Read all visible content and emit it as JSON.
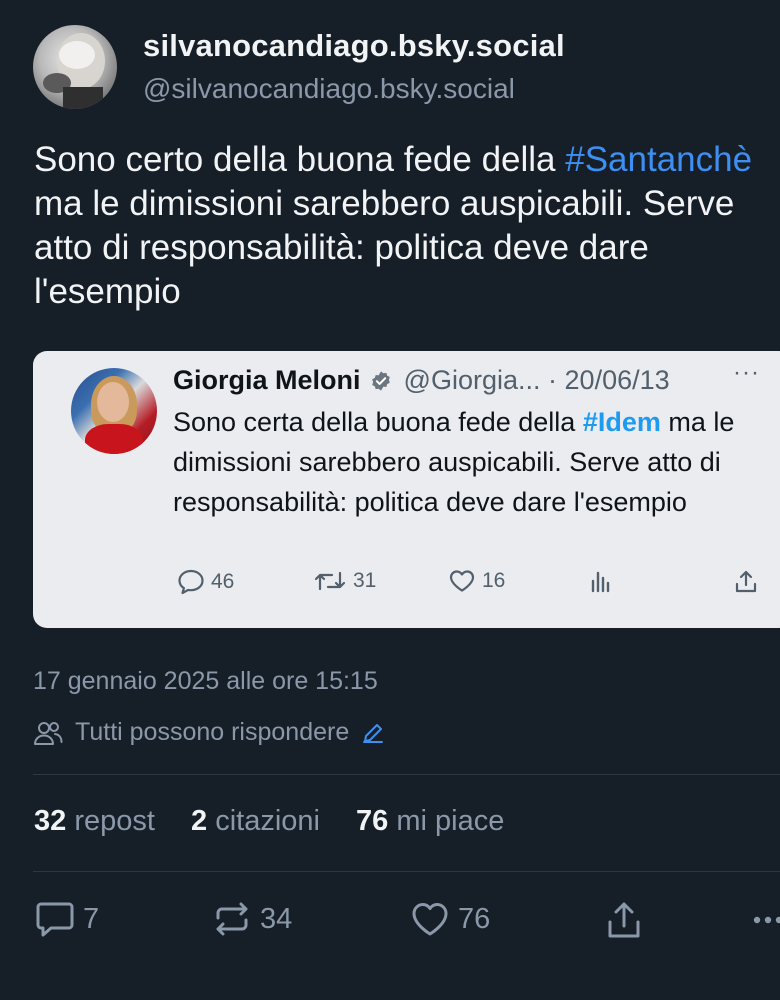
{
  "post": {
    "author_name": "silvanocandiago.bsky.social",
    "author_handle": "@silvanocandiago.bsky.social",
    "text_before": "Sono certo della buona fede della ",
    "hashtag": "#Santanchè",
    "text_after": " ma le dimissioni sarebbero auspicabili. Serve atto di responsabilità: politica deve dare l'esempio",
    "timestamp": "17 gennaio 2025 alle ore 15:15",
    "reply_setting": "Tutti possono rispondere"
  },
  "embed": {
    "author_name": "Giorgia Meloni",
    "author_handle": "@Giorgia...",
    "separator": "·",
    "date": "20/06/13",
    "more": "···",
    "text_before": "Sono certa della buona fede della ",
    "hashtag": "#Idem",
    "text_after": " ma le dimissioni sarebbero auspicabili. Serve atto di responsabilità: politica deve dare l'esempio",
    "replies": "46",
    "retweets": "31",
    "likes": "16"
  },
  "stats": {
    "reposts_count": "32",
    "reposts_label": "repost",
    "quotes_count": "2",
    "quotes_label": "citazioni",
    "likes_count": "76",
    "likes_label": "mi piace"
  },
  "actions": {
    "replies": "7",
    "reposts": "34",
    "likes": "76"
  },
  "colors": {
    "background": "#161e27",
    "hashtag": "#3e8ff2",
    "muted": "#8b98a9",
    "embed_background": "#ebecef"
  }
}
